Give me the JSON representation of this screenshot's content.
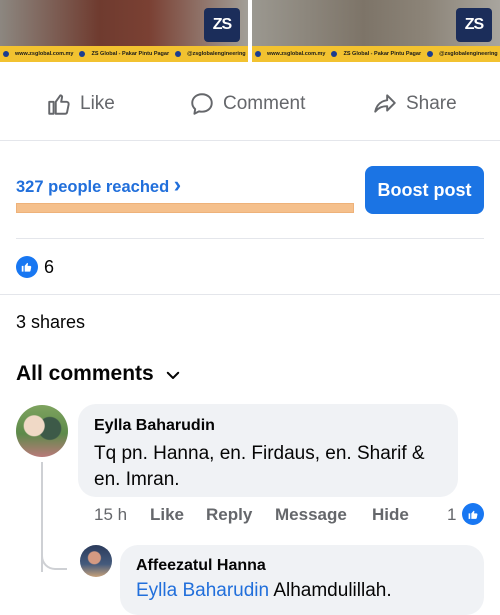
{
  "top_images": {
    "left": {
      "logo_text": "ZS",
      "banner": {
        "website": "www.zsglobal.com.my",
        "facebook": "ZS Global - Pakar Pintu Pagar",
        "instagram": "@zsglobalengineering"
      }
    },
    "right": {
      "logo_text": "ZS",
      "banner": {
        "website": "www.zsglobal.com.my",
        "facebook": "ZS Global - Pakar Pintu Pagar",
        "instagram": "@zsglobalengineering"
      }
    }
  },
  "actions": {
    "like": "Like",
    "comment": "Comment",
    "share": "Share"
  },
  "insights": {
    "reach_text": "327 people reached",
    "reach_chevron": "›",
    "boost_label": "Boost post"
  },
  "reactions": {
    "like_count": "6"
  },
  "shares_text": "3 shares",
  "comments_header": {
    "label": "All comments"
  },
  "comments": [
    {
      "author": "Eylla Baharudin",
      "text": "Tq pn. Hanna, en. Firdaus, en. Sharif & en. Imran.",
      "time": "15 h",
      "like_action": "Like",
      "reply_action": "Reply",
      "message_action": "Message",
      "hide_action": "Hide",
      "like_count": "1"
    },
    {
      "author": "Affeezatul Hanna",
      "mention": "Eylla Baharudin",
      "text": "Alhamdulillah."
    }
  ],
  "colors": {
    "accent": "#1b74e4",
    "link": "#216fdb",
    "reach_bar": "#f5c08c",
    "bubble": "#f0f2f5"
  }
}
